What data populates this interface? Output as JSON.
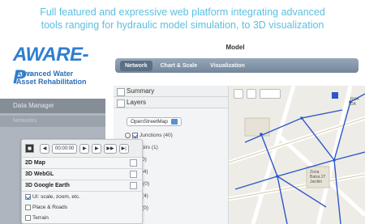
{
  "headline": {
    "line1": "Full featured and expressive web platform integrating advanced",
    "line2": "tools ranging for hydraulic model simulation, to 3D visualization"
  },
  "brand": {
    "logo": "AWARE-P",
    "logo_arrows": "»",
    "tagline_line1": "Advanced Water",
    "tagline_line2": "Asset Rehabilitation"
  },
  "sidebar": {
    "header": "Data Manager",
    "item": "Networks"
  },
  "app": {
    "title": "Model",
    "tabs": [
      "Network",
      "Chart & Scale",
      "Visualization"
    ],
    "active_tab": 0
  },
  "panel": {
    "summary_label": "Summary",
    "layers_label": "Layers",
    "basemap_select": "OpenStreetMap",
    "layers": [
      {
        "label": "Junctions (40)",
        "checked": true
      },
      {
        "label": "Reservoirs (1)",
        "checked": false
      },
      {
        "label": "Tanks (0)",
        "checked": false
      },
      {
        "label": "Links (54)",
        "checked": false
      },
      {
        "label": "Pumps (0)",
        "checked": false
      },
      {
        "label": "Valves (4)",
        "checked": false
      },
      {
        "label": "Labels (0)",
        "checked": false
      }
    ]
  },
  "map": {
    "label_block": "Zona Baixa 27 Jardim",
    "label_top": "RUA DA"
  },
  "floater": {
    "time": "00:00:00",
    "menu": [
      {
        "label": "2D Map"
      },
      {
        "label": "3D WebGL"
      },
      {
        "label": "3D Google Earth"
      }
    ],
    "options": [
      {
        "label": "UI: scale, zoom, etc.",
        "checked": true
      },
      {
        "label": "Place & Roads",
        "checked": false
      },
      {
        "label": "Terrain",
        "checked": false
      }
    ]
  },
  "colors": {
    "headline": "#5bbfe0",
    "logo": "#2f7fd0",
    "tab_bar": "#73859a",
    "sidebar": "#aeb5be"
  }
}
